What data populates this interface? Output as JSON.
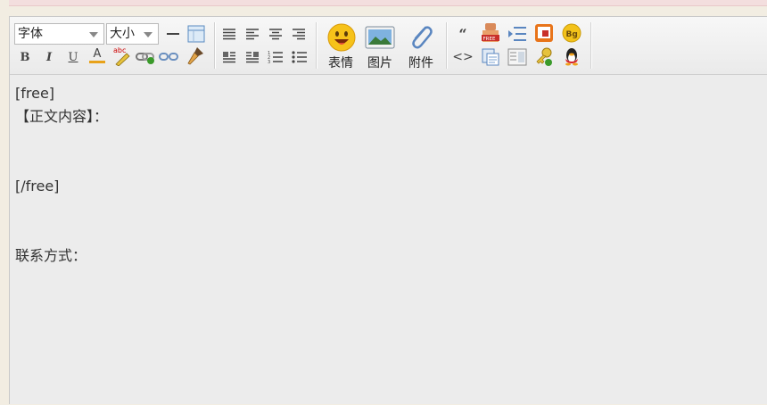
{
  "toolbar": {
    "font_select": "字体",
    "size_select": "大小",
    "bold": "B",
    "italic": "I",
    "underline": "U",
    "font_color": "A",
    "spell": "abc",
    "quote": "“",
    "code": "<>",
    "free_badge": "FREE",
    "bg_badge": "Bg",
    "emoji_label": "表情",
    "image_label": "图片",
    "attach_label": "附件"
  },
  "content": {
    "lines": [
      "[free]",
      "【正文内容】：",
      "",
      "",
      "[/free]",
      "",
      "",
      "联系方式：",
      "",
      ""
    ]
  }
}
